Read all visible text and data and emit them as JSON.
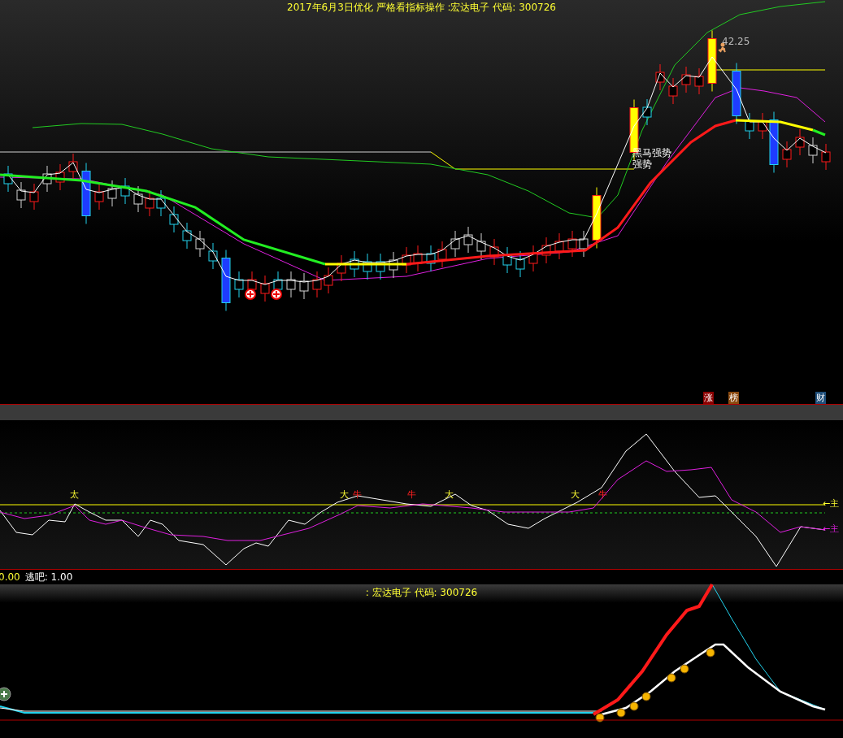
{
  "top_chart": {
    "title": "2017年6月3日优化 严格看指标操作 :宏达电子 代码: 300726",
    "price_label": "42.25",
    "signal_labels": [
      "黑马强势",
      "强势"
    ],
    "badges": [
      {
        "text": "涨",
        "color": "#8b0000"
      },
      {
        "text": "榜",
        "color": "#8b4a10"
      },
      {
        "text": "财",
        "color": "#1f4e79"
      }
    ]
  },
  "indicator_chart": {
    "markers": [
      {
        "text": "太",
        "kind": "big"
      },
      {
        "text": "大",
        "kind": "big"
      },
      {
        "text": "牛",
        "kind": "bull"
      },
      {
        "text": "牛",
        "kind": "bull"
      },
      {
        "text": "大",
        "kind": "big"
      },
      {
        "text": "大",
        "kind": "big"
      },
      {
        "text": "牛",
        "kind": "bull"
      }
    ],
    "line_labels": [
      "←主",
      "←主"
    ],
    "readout": {
      "value": "0.00",
      "label": "逃吧: 1.00"
    }
  },
  "bottom_chart": {
    "title": ": 宏达电子 代码: 300726"
  }
}
